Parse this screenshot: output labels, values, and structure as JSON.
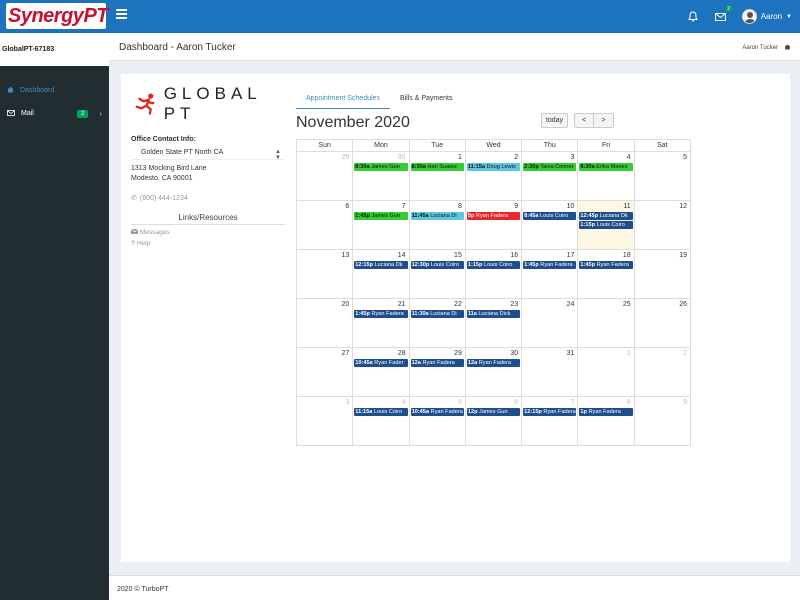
{
  "app": {
    "logo_text_main": "Synergy",
    "logo_text_suffix": "PT"
  },
  "topbar": {
    "mail_badge": "2",
    "user_name": "Aaron"
  },
  "sidebar": {
    "title": "GlobalPT-67183",
    "items": [
      {
        "label": "Dashboard",
        "icon": "dashboard-icon"
      },
      {
        "label": "Mail",
        "icon": "envelope-icon",
        "badge": "2"
      }
    ]
  },
  "header": {
    "title": "Dashboard - Aaron Tucker",
    "breadcrumb": "Aaron Tucker"
  },
  "brand": {
    "name": "GLOBAL PT"
  },
  "office": {
    "title": "Office Contact Info:",
    "location": "Golden State PT North CA",
    "address_line1": "1313 Mocking Bird Lane",
    "address_line2": "Modesto, CA 90001",
    "phone": "(800) 444-1234",
    "links_title": "Links/Resources",
    "links": [
      "Messages",
      "Help"
    ]
  },
  "tabs": [
    "Appointment Schedules",
    "Bills & Payments"
  ],
  "calendar": {
    "title": "November 2020",
    "today_label": "today",
    "prev_symbol": "<",
    "next_symbol": ">",
    "day_headers": [
      "Sun",
      "Mon",
      "Tue",
      "Wed",
      "Thu",
      "Fri",
      "Sat"
    ],
    "colors": {
      "green": "#33cc33",
      "cyan": "#5bc8e0",
      "red": "#e8272b",
      "blue": "#1f4e8c"
    },
    "weeks": [
      [
        {
          "d": "29",
          "other": true,
          "events": []
        },
        {
          "d": "30",
          "other": true,
          "events": [
            {
              "time": "8:30a",
              "name": "James Gun",
              "color": "green"
            }
          ]
        },
        {
          "d": "1",
          "events": [
            {
              "time": "8:30a",
              "name": "Han Suarez",
              "color": "green"
            }
          ]
        },
        {
          "d": "2",
          "events": [
            {
              "time": "11:15a",
              "name": "Doug Lewis",
              "color": "cyan"
            }
          ]
        },
        {
          "d": "3",
          "events": [
            {
              "time": "2:30p",
              "name": "Tania Conner",
              "color": "green"
            }
          ]
        },
        {
          "d": "4",
          "events": [
            {
              "time": "8:30a",
              "name": "Erika Manes",
              "color": "green"
            }
          ]
        },
        {
          "d": "5",
          "events": []
        }
      ],
      [
        {
          "d": "6",
          "events": []
        },
        {
          "d": "7",
          "events": [
            {
              "time": "1:45p",
              "name": "James Gun",
              "color": "green"
            }
          ]
        },
        {
          "d": "8",
          "events": [
            {
              "time": "11:45a",
              "name": "Luciana Di",
              "color": "cyan"
            }
          ]
        },
        {
          "d": "9",
          "events": [
            {
              "time": "5p",
              "name": "Ryan Fadera",
              "color": "red"
            }
          ]
        },
        {
          "d": "10",
          "events": [
            {
              "time": "8:45a",
              "name": "Louis Coiro",
              "color": "blue"
            }
          ]
        },
        {
          "d": "11",
          "today": true,
          "events": [
            {
              "time": "12:45p",
              "name": "Luciana Dk",
              "color": "blue"
            },
            {
              "time": "1:15p",
              "name": "Louis Coiro",
              "color": "blue"
            }
          ]
        },
        {
          "d": "12",
          "events": []
        }
      ],
      [
        {
          "d": "13",
          "events": []
        },
        {
          "d": "14",
          "events": [
            {
              "time": "12:15p",
              "name": "Luciana Dk",
              "color": "blue"
            }
          ]
        },
        {
          "d": "15",
          "events": [
            {
              "time": "12:30p",
              "name": "Louis Coiro",
              "color": "blue"
            }
          ]
        },
        {
          "d": "16",
          "events": [
            {
              "time": "1:15p",
              "name": "Louis Coiro",
              "color": "blue"
            }
          ]
        },
        {
          "d": "17",
          "events": [
            {
              "time": "1:45p",
              "name": "Ryan Fadera",
              "color": "blue"
            }
          ]
        },
        {
          "d": "18",
          "events": [
            {
              "time": "1:45p",
              "name": "Ryan Fadera",
              "color": "blue"
            }
          ]
        },
        {
          "d": "19",
          "events": []
        }
      ],
      [
        {
          "d": "20",
          "events": []
        },
        {
          "d": "21",
          "events": [
            {
              "time": "1:45p",
              "name": "Ryan Fadera",
              "color": "blue"
            }
          ]
        },
        {
          "d": "22",
          "events": [
            {
              "time": "11:30a",
              "name": "Luciana Di",
              "color": "blue"
            }
          ]
        },
        {
          "d": "23",
          "events": [
            {
              "time": "11a",
              "name": "Luciana Dick",
              "color": "blue"
            }
          ]
        },
        {
          "d": "24",
          "events": []
        },
        {
          "d": "25",
          "events": []
        },
        {
          "d": "26",
          "events": []
        }
      ],
      [
        {
          "d": "27",
          "events": []
        },
        {
          "d": "28",
          "events": [
            {
              "time": "10:45a",
              "name": "Ryan Fader",
              "color": "blue"
            }
          ]
        },
        {
          "d": "29",
          "events": [
            {
              "time": "12a",
              "name": "Ryan Fadera",
              "color": "blue"
            }
          ]
        },
        {
          "d": "30",
          "events": [
            {
              "time": "12a",
              "name": "Ryan Fadera",
              "color": "blue"
            }
          ]
        },
        {
          "d": "31",
          "events": []
        },
        {
          "d": "1",
          "other": true,
          "events": []
        },
        {
          "d": "2",
          "other": true,
          "events": []
        }
      ],
      [
        {
          "d": "3",
          "other": true,
          "events": []
        },
        {
          "d": "4",
          "other": true,
          "events": [
            {
              "time": "11:15a",
              "name": "Louis Coiro",
              "color": "blue"
            }
          ]
        },
        {
          "d": "5",
          "other": true,
          "events": [
            {
              "time": "10:45a",
              "name": "Ryan Fadera",
              "color": "blue"
            }
          ]
        },
        {
          "d": "6",
          "other": true,
          "events": [
            {
              "time": "12p",
              "name": "James Gun",
              "color": "blue"
            }
          ]
        },
        {
          "d": "7",
          "other": true,
          "events": [
            {
              "time": "12:15p",
              "name": "Ryan Fadera",
              "color": "blue"
            }
          ]
        },
        {
          "d": "8",
          "other": true,
          "events": [
            {
              "time": "1p",
              "name": "Ryan Fadera",
              "color": "blue"
            }
          ]
        },
        {
          "d": "9",
          "other": true,
          "events": []
        }
      ]
    ]
  },
  "footer": {
    "text": "2020 © TurboPT"
  }
}
